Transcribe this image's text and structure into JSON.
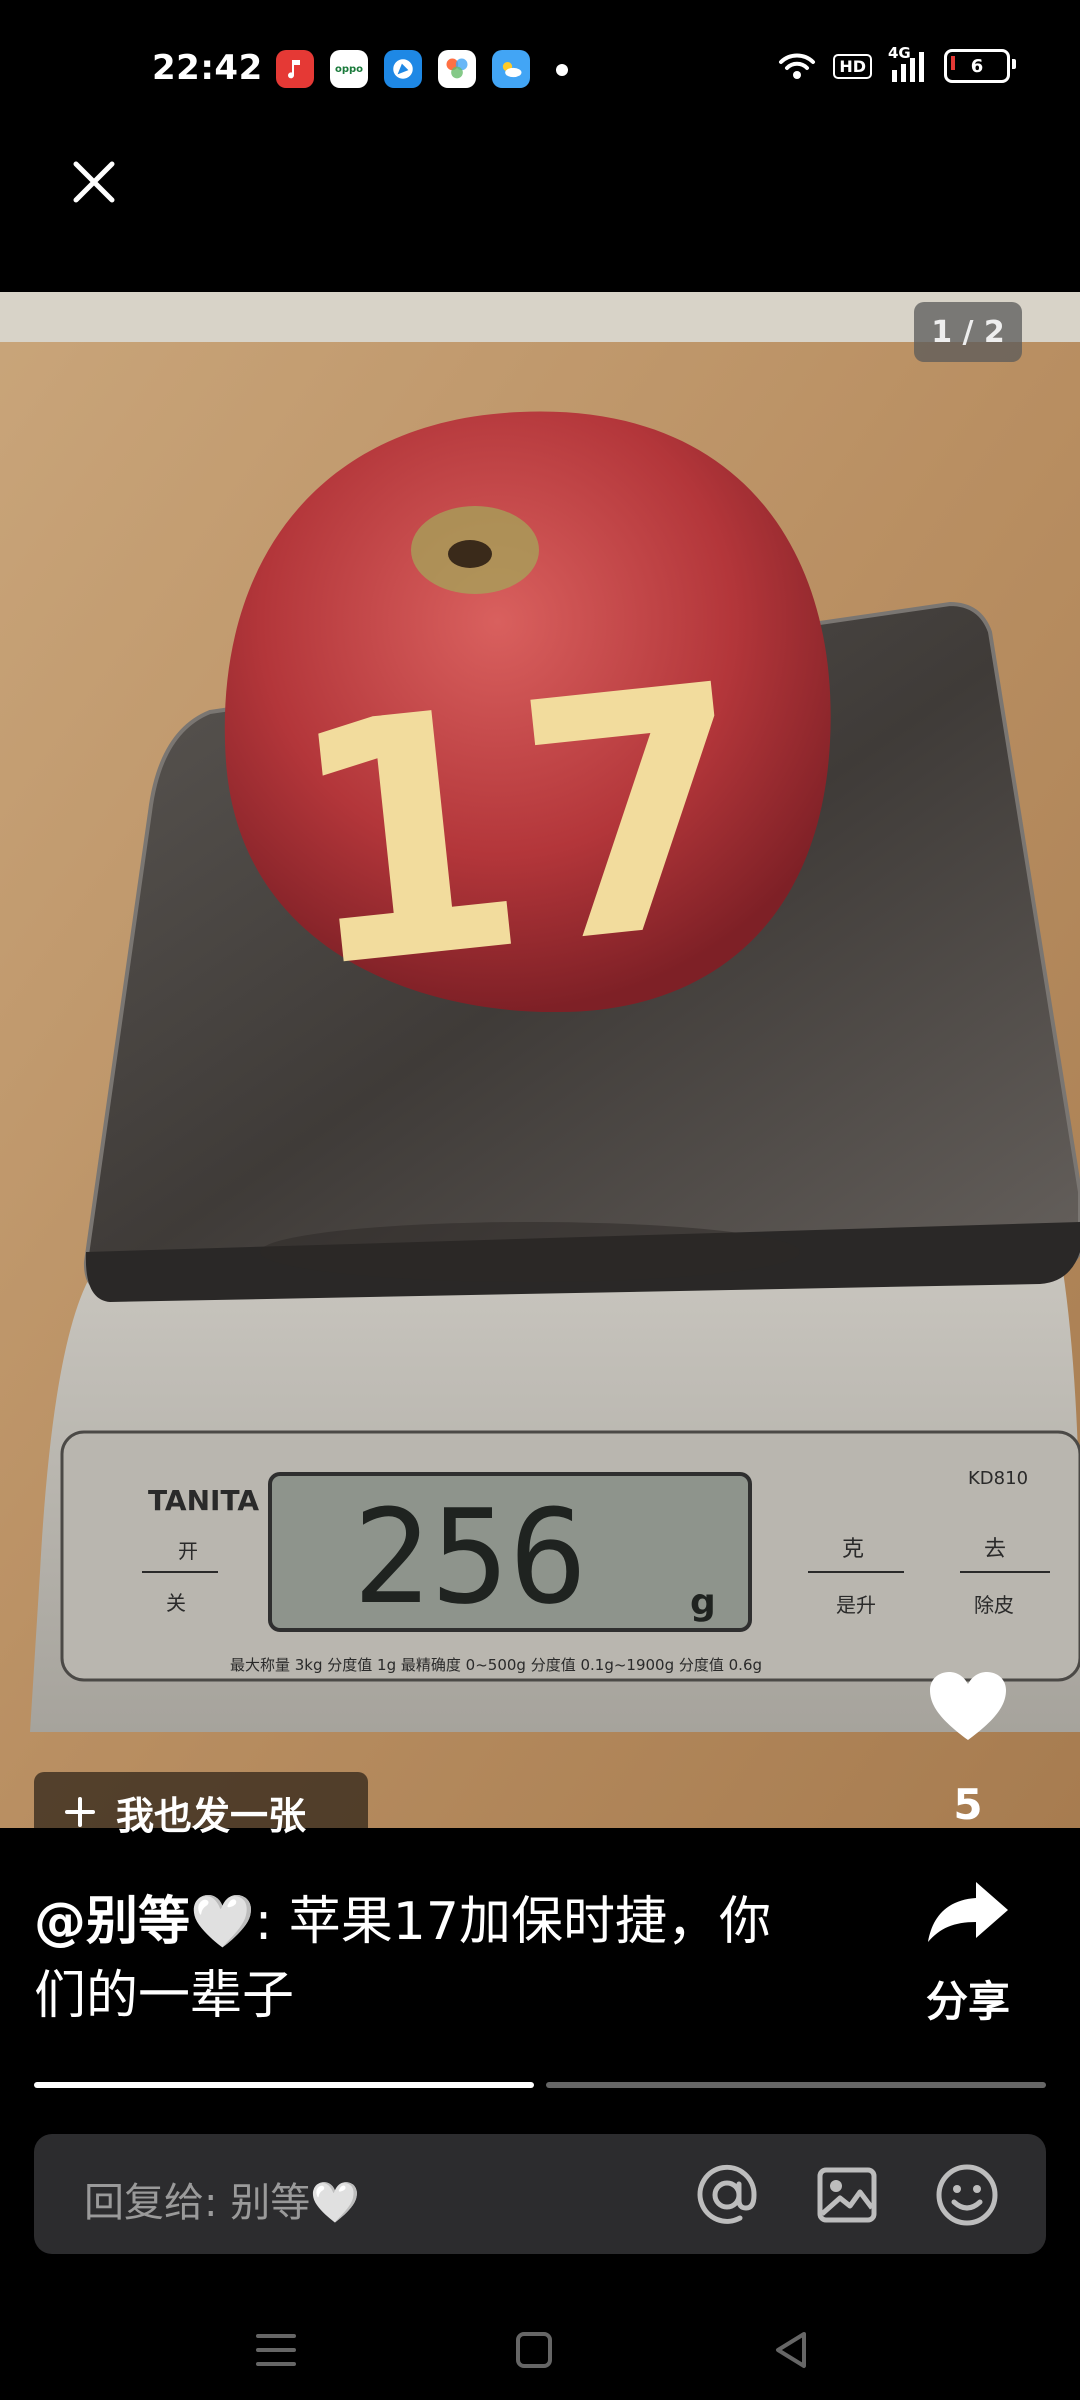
{
  "status_bar": {
    "time": "22:42",
    "app_icons": [
      "music-app-icon",
      "oppo-app-icon",
      "browser-app-icon",
      "gallery-app-icon",
      "weather-app-icon"
    ],
    "oppo_label": "oppo",
    "network": "4G",
    "hd_label": "HD",
    "battery_level": "6"
  },
  "viewer": {
    "counter": "1 / 2",
    "post_button_label": "我也发一张",
    "like_count": "5"
  },
  "caption": {
    "author": "@别等🤍",
    "text": ": 苹果17加保时捷，你们的一辈子"
  },
  "share": {
    "label": "分享"
  },
  "progress": {
    "current": 1,
    "total": 2
  },
  "reply": {
    "placeholder": "回复给: 别等🤍"
  },
  "photo": {
    "apple_label": "17",
    "scale_brand": "TANITA",
    "scale_reading": "256",
    "scale_unit": "g",
    "scale_model": "KD810",
    "scale_kaiguan_top": "开",
    "scale_kaiguan_bottom": "关",
    "scale_ke": "克",
    "scale_shengsheng": "是升",
    "scale_qu": "去",
    "scale_pi": "除皮",
    "scale_fine_print": "最大称量 3kg 分度值 1g 最精确度 0~500g 分度值 0.1g~1900g 分度值 0.6g"
  },
  "colors": {
    "background": "#000000",
    "reply_bar": "#2c2c2e",
    "progress_active": "#ffffff",
    "progress_inactive": "#666666"
  }
}
